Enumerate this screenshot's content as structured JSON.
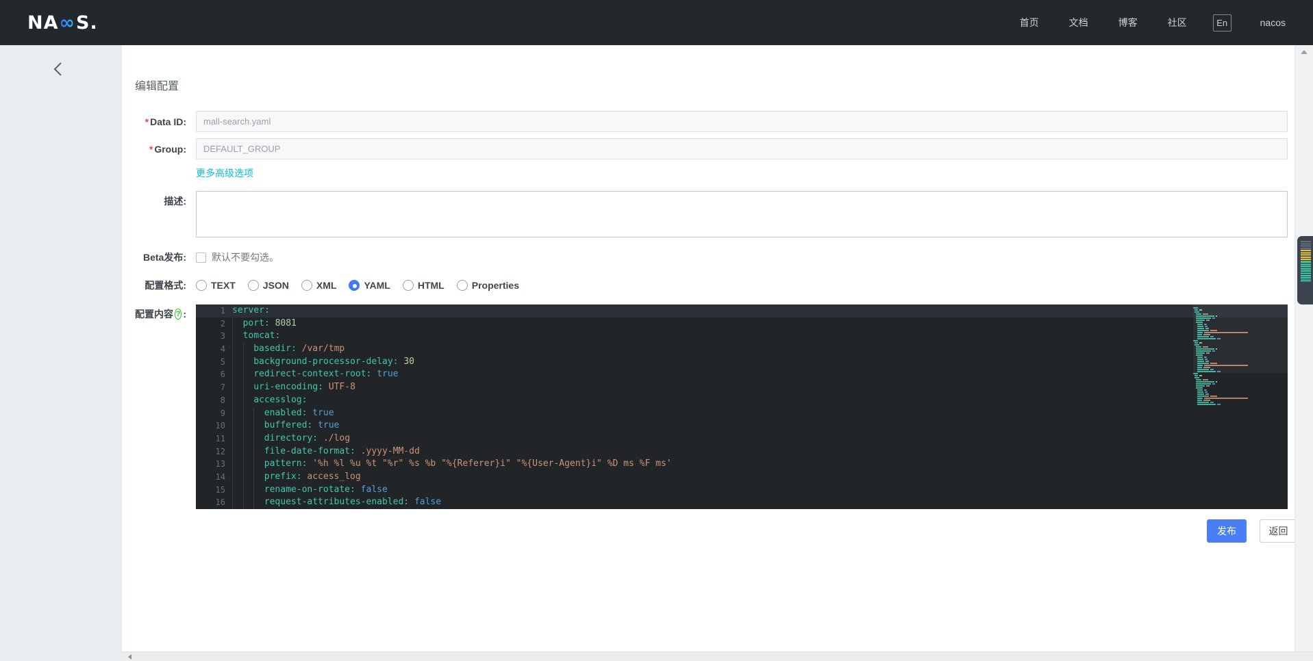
{
  "navbar": {
    "logo": {
      "pre": "NA",
      "mid": "∞",
      "post": "S."
    },
    "links": [
      "首页",
      "文档",
      "博客",
      "社区"
    ],
    "lang_button": "En",
    "username": "nacos"
  },
  "sidebar": {
    "back_icon": "chevron-left"
  },
  "page": {
    "title": "编辑配置"
  },
  "form": {
    "required_mark": "*",
    "data_id": {
      "label": "Data ID:",
      "value": "mall-search.yaml"
    },
    "group": {
      "label": "Group:",
      "value": "DEFAULT_GROUP"
    },
    "advanced_options_link": "更多高级选项",
    "description": {
      "label": "描述:",
      "value": ""
    },
    "beta": {
      "label": "Beta发布:",
      "hint": "默认不要勾选。",
      "checked": false
    },
    "format": {
      "label": "配置格式:",
      "options": [
        "TEXT",
        "JSON",
        "XML",
        "YAML",
        "HTML",
        "Properties"
      ],
      "selected": "YAML"
    },
    "content": {
      "label": "配置内容",
      "help_icon": "?",
      "colon": ":"
    }
  },
  "editor": {
    "current_line": 1,
    "lines": [
      {
        "no": 1,
        "indent": 0,
        "key": "server",
        "value": "",
        "vtype": "none"
      },
      {
        "no": 2,
        "indent": 1,
        "key": "port",
        "value": "8081",
        "vtype": "num"
      },
      {
        "no": 3,
        "indent": 1,
        "key": "tomcat",
        "value": "",
        "vtype": "none"
      },
      {
        "no": 4,
        "indent": 2,
        "key": "basedir",
        "value": "/var/tmp",
        "vtype": "str"
      },
      {
        "no": 5,
        "indent": 2,
        "key": "background-processor-delay",
        "value": "30",
        "vtype": "num"
      },
      {
        "no": 6,
        "indent": 2,
        "key": "redirect-context-root",
        "value": "true",
        "vtype": "bool"
      },
      {
        "no": 7,
        "indent": 2,
        "key": "uri-encoding",
        "value": "UTF-8",
        "vtype": "str"
      },
      {
        "no": 8,
        "indent": 2,
        "key": "accesslog",
        "value": "",
        "vtype": "none"
      },
      {
        "no": 9,
        "indent": 3,
        "key": "enabled",
        "value": "true",
        "vtype": "bool"
      },
      {
        "no": 10,
        "indent": 3,
        "key": "buffered",
        "value": "true",
        "vtype": "bool"
      },
      {
        "no": 11,
        "indent": 3,
        "key": "directory",
        "value": "./log",
        "vtype": "str"
      },
      {
        "no": 12,
        "indent": 3,
        "key": "file-date-format",
        "value": ".yyyy-MM-dd",
        "vtype": "str"
      },
      {
        "no": 13,
        "indent": 3,
        "key": "pattern",
        "value": "'%h %l %u %t \"%r\" %s %b \"%{Referer}i\" \"%{User-Agent}i\" %D ms %F ms'",
        "vtype": "str"
      },
      {
        "no": 14,
        "indent": 3,
        "key": "prefix",
        "value": "access_log",
        "vtype": "str"
      },
      {
        "no": 15,
        "indent": 3,
        "key": "rename-on-rotate",
        "value": "false",
        "vtype": "bool"
      },
      {
        "no": 16,
        "indent": 3,
        "key": "request-attributes-enabled",
        "value": "false",
        "vtype": "bool"
      }
    ]
  },
  "actions": {
    "publish": "发布",
    "back": "返回"
  },
  "colors": {
    "navbar_bg": "#23282d",
    "sidebar_bg": "#e9ecf0",
    "accent_blue": "#4a7ef5",
    "link_teal": "#06c1de",
    "required_red": "#ff4343",
    "help_green": "#2bc52b",
    "editor_bg": "#212528",
    "syntax_key": "#3fc8ae",
    "syntax_num": "#b5cea8",
    "syntax_str": "#ce9178",
    "syntax_bool": "#569cd6"
  }
}
